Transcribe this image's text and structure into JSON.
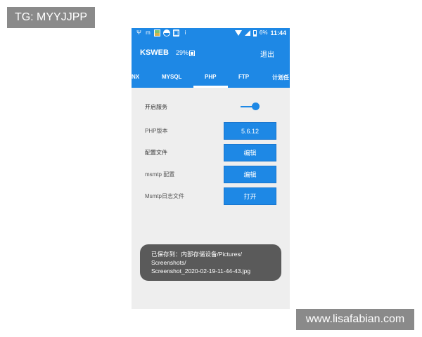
{
  "watermark": {
    "tg": "TG: MYYJJPP",
    "site": "www.lisafabian.com"
  },
  "statusbar": {
    "icons": [
      "usb-icon",
      "m-icon",
      "gallery-icon",
      "half-circle-icon",
      "photo-icon",
      "info-icon"
    ],
    "battery": "6%",
    "time": "11:44"
  },
  "appbar": {
    "title": "KSWEB",
    "cpu": "29%",
    "exit": "退出"
  },
  "tabs": [
    "NX",
    "MYSQL",
    "PHP",
    "FTP",
    "计划任"
  ],
  "active_tab": "PHP",
  "settings": {
    "service": {
      "label": "开启服务",
      "enabled": true
    },
    "php_version": {
      "label": "PHP版本",
      "button": "5.6.12"
    },
    "config_file": {
      "label": "配置文件",
      "button": "编辑"
    },
    "msmtp_config": {
      "label": "msmtp 配置",
      "button": "编辑"
    },
    "msmtp_log": {
      "label": "Msmtp日志文件",
      "button": "打开"
    }
  },
  "toast": {
    "line1": "已保存到：内部存储设备/Pictures/",
    "line2": "Screenshots/",
    "line3": "Screenshot_2020-02-19-11-44-43.jpg"
  },
  "colors": {
    "accent": "#1e88e5",
    "background": "#eeeeee",
    "toast": "#5a5a5a"
  }
}
